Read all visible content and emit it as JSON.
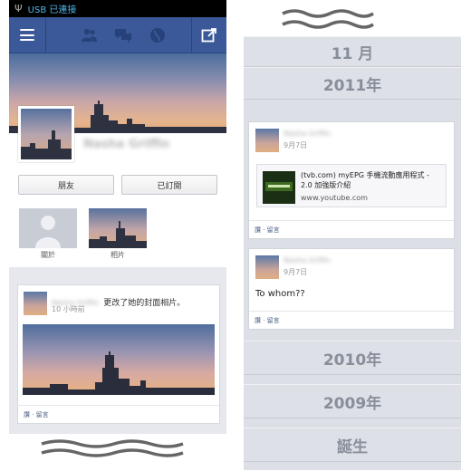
{
  "left": {
    "status": {
      "usb_label": "USB 已連接"
    },
    "profile": {
      "name": "Nasha Griffin"
    },
    "buttons": {
      "friends": "朋友",
      "subscribed": "已訂閱"
    },
    "tiles": {
      "about": "關於",
      "photos": "相片"
    },
    "post": {
      "author": "Nasha Griffin",
      "action": "更改了她的封面相片。",
      "time": "10 小時前",
      "actions": "讚 · 留言"
    }
  },
  "right": {
    "month": "11 月",
    "years": [
      "2011年",
      "2010年",
      "2009年"
    ],
    "birth": "誕生",
    "post1": {
      "author": "Nasha Griffin",
      "date": "9月7日",
      "link_title": "(tvb.com) myEPG 手機流動應用程式 - 2.0 加強版介紹",
      "link_url": "www.youtube.com",
      "actions": "讚 · 留言"
    },
    "post2": {
      "author": "Nasha Griffin",
      "date": "9月7日",
      "text": "To whom??",
      "actions": "讚 · 留言"
    }
  },
  "icons": [
    "usb-icon",
    "menu-icon",
    "friends-icon",
    "messages-icon",
    "globe-icon",
    "share-icon"
  ],
  "colors": {
    "fb_blue": "#3b5998",
    "status_text": "#4fb5e8",
    "link": "#4a5d86"
  }
}
